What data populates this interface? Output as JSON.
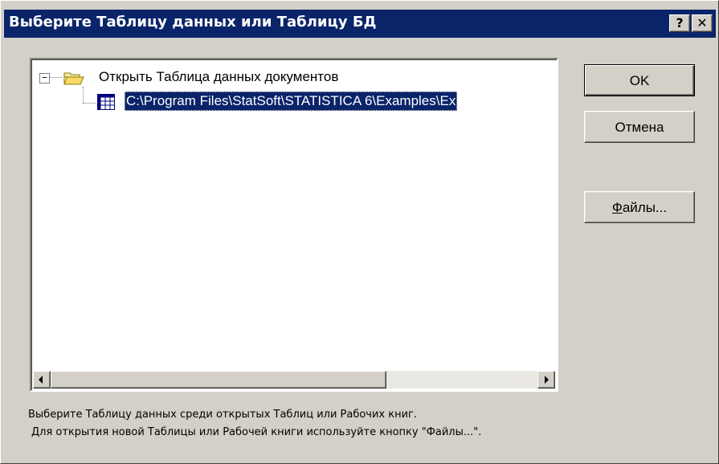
{
  "window": {
    "title": "Выберите Таблицу данных или Таблицу БД",
    "help_glyph": "?",
    "close_glyph": "✕"
  },
  "tree": {
    "root": {
      "expander": "−",
      "icon": "open-folder-icon",
      "label": "Открыть Таблица данных документов"
    },
    "children": [
      {
        "icon": "spreadsheet-icon",
        "label": "C:\\Program Files\\StatSoft\\STATISTICA 6\\Examples\\Ex",
        "selected": true
      }
    ]
  },
  "buttons": {
    "ok": "OK",
    "cancel": "Отмена",
    "files_mnemonic": "Ф",
    "files_rest": "айлы..."
  },
  "hint": {
    "line1": "Выберите Таблицу данных среди открытых Таблиц или Рабочих книг.",
    "line2": "Для открытия новой Таблицы или Рабочей книги используйте кнопку \"Файлы...\"."
  },
  "colors": {
    "titlebar": "#0a246a",
    "face": "#d4d0c8",
    "selection": "#0a246a"
  }
}
